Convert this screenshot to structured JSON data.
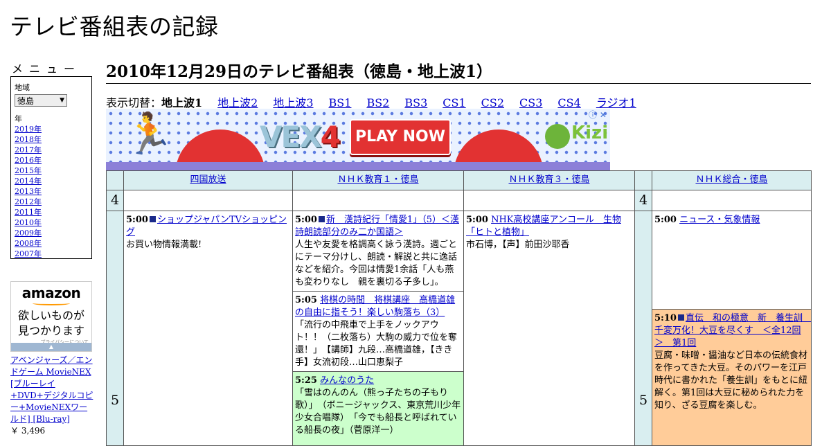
{
  "site": {
    "title": "テレビ番組表の記録"
  },
  "menu": {
    "heading": "メニュー",
    "region_label": "地域",
    "region_value": "徳島",
    "year_label": "年",
    "years": [
      "2019年",
      "2018年",
      "2017年",
      "2016年",
      "2015年",
      "2014年",
      "2013年",
      "2012年",
      "2011年",
      "2010年",
      "2009年",
      "2008年",
      "2007年"
    ]
  },
  "amazon": {
    "logo": "amazon",
    "text_line1": "欲しいものが",
    "text_line2": "見つかります",
    "privacy": "プライバシーについて",
    "product_title": "アベンジャーズ／エンドゲーム MovieNEX [ブルーレイ+DVD+デジタルコピー+MovieNEXワールド] [Blu-ray]",
    "product_price": "￥ 3,496"
  },
  "main": {
    "heading": "2010年12月29日のテレビ番組表（徳島・地上波1）",
    "switch_label": "表示切替：",
    "current": "地上波1",
    "links": [
      "地上波2",
      "地上波3",
      "BS1",
      "BS2",
      "BS3",
      "CS1",
      "CS2",
      "CS3",
      "CS4",
      "ラジオ1"
    ]
  },
  "ad": {
    "vex": "VEX",
    "vex_num": "4",
    "play": "PLAY NOW",
    "kizi": "Kizi",
    "info": "ⓘ ✕"
  },
  "schedule": {
    "channels": [
      "四国放送",
      "ＮＨＫ教育１・徳島",
      "ＮＨＫ教育３・徳島",
      "ＮＨＫ総合・徳島"
    ],
    "hours": [
      "4",
      "5"
    ],
    "programs": {
      "shikoku_500": {
        "time": "5:00",
        "title": "ショップジャパンTVショッピング",
        "desc": "お買い物情報満載!"
      },
      "edu1_500": {
        "time": "5:00",
        "title": "新　漢詩紀行「情愛1」（5）＜漢詩朗読部分のみ二か国語＞",
        "desc": "人生や友愛を格調高く詠う漢詩。週ごとにテーマ分けし、朗読・解説と共に逸話などを紹介。今回は情愛1余話「人も燕も変わりなし　親を裏切る子多し」。"
      },
      "edu1_505": {
        "time": "5:05",
        "title": "将棋の時間　将棋講座　高橋道雄の自由に指そう！楽しい駒落ち（3）",
        "desc": "「流行の中飛車で上手をノックアウト！！（二枚落ち）大駒の威力で位を奪還！」　【講師】九段…高橋道雄，【きき手】女流初段…山口恵梨子"
      },
      "edu1_525": {
        "time": "5:25",
        "title": "みんなのうた",
        "desc": "「雪はのんのん（熊っ子たちの子もり歌）」　（ボニージャックス、東京荒川少年少女合唱隊）　「今でも船長と呼ばれている船長の夜」（菅原洋一）"
      },
      "edu3_500": {
        "time": "5:00",
        "title": "NHK高校講座アンコール　生物「ヒトと植物」",
        "desc": "市石博，【声】前田沙耶香"
      },
      "sogo_500": {
        "time": "5:00",
        "title": "ニュース・気象情報",
        "desc": ""
      },
      "sogo_510": {
        "time": "5:10",
        "title": "直伝　和の極意　新　養生訓　千変万化！大豆を尽くす　＜全12回＞　第1回",
        "desc": "豆腐・味噌・醤油など日本の伝統食材を作ってきた大豆。そのパワーを江戸時代に書かれた「養生訓」をもとに紐解く。第1回は大豆に秘められた力を知り、ざる豆腐を楽しむ。"
      }
    }
  },
  "colors": {
    "header_bg": "#d9eef0",
    "music_bg": "#ccffcc",
    "culture_bg": "#ffcc99",
    "link": "#0000cc"
  }
}
